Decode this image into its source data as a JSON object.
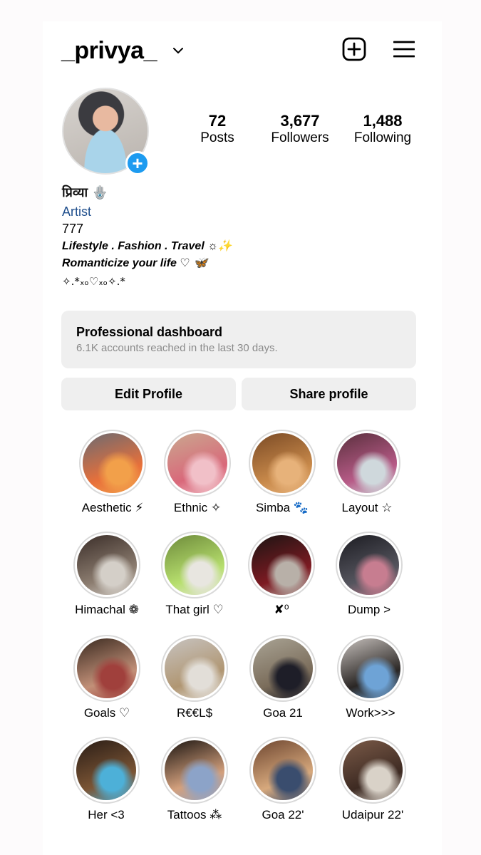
{
  "header": {
    "username": "_privya_",
    "dropdown_icon": "chevron-down-icon",
    "create_icon": "plus-square-icon",
    "menu_icon": "hamburger-menu-icon"
  },
  "profile": {
    "avatar_icon": "profile-photo",
    "add_story_icon": "plus-circle-icon",
    "stats": [
      {
        "value": "72",
        "label": "Posts"
      },
      {
        "value": "3,677",
        "label": "Followers"
      },
      {
        "value": "1,488",
        "label": "Following"
      }
    ]
  },
  "bio": {
    "name": "प्रिव्या 🪬",
    "category": "Artist",
    "line1": "777",
    "line2": "Lifestyle . Fashion . Travel ☼✨",
    "line3": "Romanticize your life ♡ 🦋",
    "line4": "✧.*ₓₒ♡ₓₒ✧.*"
  },
  "dashboard": {
    "title": "Professional dashboard",
    "subtitle": "6.1K accounts reached in the last 30 days."
  },
  "buttons": {
    "edit": "Edit Profile",
    "share": "Share profile"
  },
  "highlights": [
    {
      "label": "Aesthetic ⚡",
      "colors": [
        "#6b6a72",
        "#e8703a",
        "#f2a04a"
      ]
    },
    {
      "label": "Ethnic ✧",
      "colors": [
        "#c9a88f",
        "#d9687a",
        "#f1c0c8"
      ]
    },
    {
      "label": "Simba 🐾",
      "colors": [
        "#7a4a25",
        "#c8894a",
        "#e7b27a"
      ]
    },
    {
      "label": "Layout ☆",
      "colors": [
        "#5a2f3d",
        "#b75b87",
        "#cfd8dc"
      ]
    },
    {
      "label": "Himachal ❁",
      "colors": [
        "#3a2d28",
        "#8c7d70",
        "#d4cfc8"
      ]
    },
    {
      "label": "That girl ♡",
      "colors": [
        "#6d8a3a",
        "#b7df6e",
        "#e8e6e0"
      ]
    },
    {
      "label": "✘⁰",
      "colors": [
        "#1b1513",
        "#7d1a22",
        "#b8b0a8"
      ]
    },
    {
      "label": "Dump >",
      "colors": [
        "#1c1c22",
        "#55555e",
        "#c77d90"
      ]
    },
    {
      "label": "Goals ♡",
      "colors": [
        "#3a2a20",
        "#c29078",
        "#a0403c"
      ]
    },
    {
      "label": "R€€L$",
      "colors": [
        "#c7c3c0",
        "#b09672",
        "#e2ded8"
      ]
    },
    {
      "label": "Goa 21",
      "colors": [
        "#a9a394",
        "#7a6c5a",
        "#1e1e28"
      ]
    },
    {
      "label": "Work>>>",
      "colors": [
        "#c6c0bc",
        "#2a2624",
        "#6ea3d6"
      ]
    },
    {
      "label": "Her <3",
      "colors": [
        "#2a1d16",
        "#7b5535",
        "#4db0d8"
      ]
    },
    {
      "label": "Tattoos ⁂",
      "colors": [
        "#1a1410",
        "#d3a07d",
        "#8ca3c8"
      ]
    },
    {
      "label": "Goa 22'",
      "colors": [
        "#6e4630",
        "#d7a97d",
        "#3a4d6e"
      ]
    },
    {
      "label": "Udaipur 22'",
      "colors": [
        "#7a5a48",
        "#3d2a22",
        "#d9d2c8"
      ]
    }
  ]
}
